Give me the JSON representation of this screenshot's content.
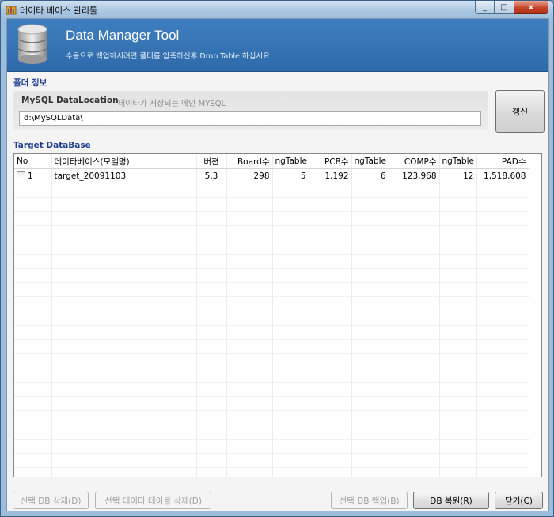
{
  "window": {
    "title": "데이타 베이스 관리툴",
    "close_glyph": "x",
    "min_glyph": "_",
    "max_glyph": "□"
  },
  "header": {
    "title": "Data Manager Tool",
    "subtitle": "수동으로 백업하시려면 폴더를 압축하신후 Drop Table 하십시요."
  },
  "folder_info": {
    "section_label": "폴더 정보",
    "location_label": "MySQL DataLocation",
    "location_hint": "데이타가 저장되는 메인 MYSQL",
    "path_value": "d:\\MySQLData\\",
    "refresh_label": "갱신"
  },
  "target": {
    "section_label": "Target DataBase",
    "columns": [
      "No",
      "데이타베이스(모델명)",
      "버젼",
      "Board수",
      "ngTable",
      "PCB수",
      "ngTable",
      "COMP수",
      "ngTable",
      "PAD수"
    ],
    "rows": [
      {
        "no": "1",
        "name": "target_20091103",
        "version": "5.3",
        "boards": "298",
        "ng1": "5",
        "pcb": "1,192",
        "ng2": "6",
        "comp": "123,968",
        "ng3": "12",
        "pad": "1,518,608"
      }
    ]
  },
  "buttons": {
    "delete_db": "선택 DB 삭제(D)",
    "delete_table": "선택 데이타 테이블 삭제(D)",
    "backup_db": "선택 DB 백업(B)",
    "restore_db": "DB 복원(R)",
    "close": "닫기(C)"
  }
}
